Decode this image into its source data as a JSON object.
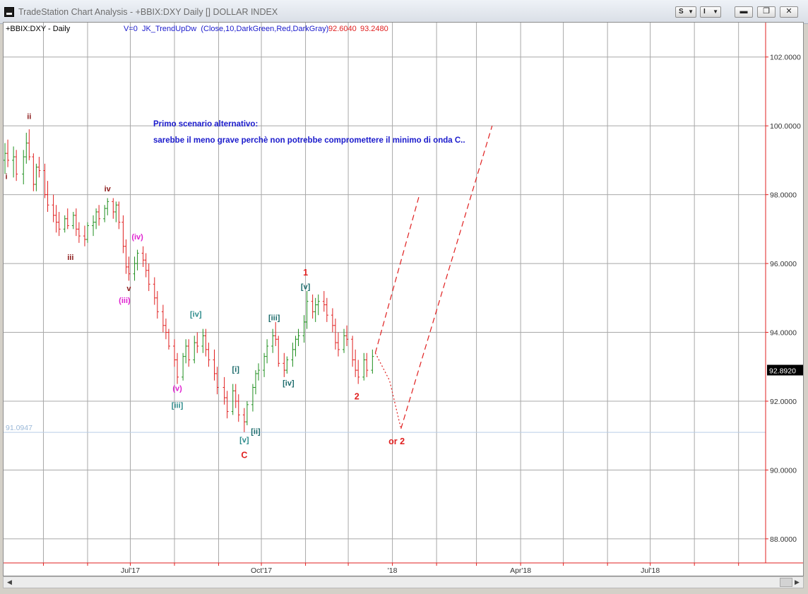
{
  "window": {
    "title": "TradeStation Chart Analysis - +BBIX:DXY Daily [] DOLLAR INDEX",
    "s_button": "S",
    "i_button": "I",
    "min": "▬",
    "max": "❐",
    "close": "✕"
  },
  "chart_data": {
    "type": "bar",
    "symbol_label": "+BBIX:DXY - Daily",
    "indicator_label": "V=0  JK_TrendUpDw  (Close,10,DarkGreen,Red,DarkGray)",
    "indicator_value1": "92.6040",
    "indicator_value2": "93.2480",
    "last_price": "92.8920",
    "ref_level": 91.0947,
    "ref_level_label": "91.0947",
    "ylim": [
      87.3,
      103.0
    ],
    "y_ticks": [
      {
        "v": 102,
        "label": "102.0000"
      },
      {
        "v": 100,
        "label": "100.0000"
      },
      {
        "v": 98,
        "label": "98.0000"
      },
      {
        "v": 96,
        "label": "96.0000"
      },
      {
        "v": 94,
        "label": "94.0000"
      },
      {
        "v": 92,
        "label": "92.0000"
      },
      {
        "v": 90,
        "label": "90.0000"
      },
      {
        "v": 88,
        "label": "88.0000"
      }
    ],
    "x_ticks": [
      {
        "date": "2017-07-01",
        "label": "Jul'17"
      },
      {
        "date": "2017-10-01",
        "label": "Oct'17"
      },
      {
        "date": "2018-01-01",
        "label": "'18"
      },
      {
        "date": "2018-04-01",
        "label": "Apr'18"
      },
      {
        "date": "2018-07-01",
        "label": "Jul'18"
      }
    ],
    "x_grid_dates": [
      "2017-05-01",
      "2017-06-01",
      "2017-07-01",
      "2017-08-01",
      "2017-09-01",
      "2017-10-01",
      "2017-11-01",
      "2017-12-01",
      "2018-01-01",
      "2018-02-01",
      "2018-03-01",
      "2018-04-01",
      "2018-05-01",
      "2018-06-01",
      "2018-07-01",
      "2018-08-01",
      "2018-09-01"
    ],
    "x_range_dates": [
      "2017-04-03",
      "2018-09-20"
    ],
    "series_colors": {
      "up": "#1f8f1f",
      "down": "#e01f1f",
      "flat": "#8a8a8a"
    },
    "bars": [
      {
        "d": "2017-04-04",
        "o": 99.0,
        "h": 99.5,
        "l": 98.6,
        "c": 99.2
      },
      {
        "d": "2017-04-06",
        "o": 99.2,
        "h": 99.6,
        "l": 98.8,
        "c": 99.0
      },
      {
        "d": "2017-04-10",
        "o": 99.0,
        "h": 99.4,
        "l": 98.5,
        "c": 99.1
      },
      {
        "d": "2017-04-12",
        "o": 99.1,
        "h": 99.3,
        "l": 98.4,
        "c": 98.6
      },
      {
        "d": "2017-04-17",
        "o": 98.6,
        "h": 99.3,
        "l": 98.3,
        "c": 99.1
      },
      {
        "d": "2017-04-19",
        "o": 99.1,
        "h": 99.8,
        "l": 98.9,
        "c": 99.5
      },
      {
        "d": "2017-04-21",
        "o": 99.5,
        "h": 99.9,
        "l": 99.0,
        "c": 99.1
      },
      {
        "d": "2017-04-24",
        "o": 99.1,
        "h": 99.2,
        "l": 98.1,
        "c": 98.3
      },
      {
        "d": "2017-04-26",
        "o": 98.3,
        "h": 98.9,
        "l": 98.1,
        "c": 98.8
      },
      {
        "d": "2017-04-28",
        "o": 98.8,
        "h": 99.1,
        "l": 98.5,
        "c": 98.7
      },
      {
        "d": "2017-05-02",
        "o": 98.7,
        "h": 98.9,
        "l": 97.9,
        "c": 98.0
      },
      {
        "d": "2017-05-04",
        "o": 98.0,
        "h": 98.4,
        "l": 97.5,
        "c": 97.7
      },
      {
        "d": "2017-05-08",
        "o": 97.7,
        "h": 98.0,
        "l": 97.2,
        "c": 97.4
      },
      {
        "d": "2017-05-10",
        "o": 97.4,
        "h": 97.7,
        "l": 96.9,
        "c": 97.2
      },
      {
        "d": "2017-05-12",
        "o": 97.2,
        "h": 97.5,
        "l": 96.8,
        "c": 97.0
      },
      {
        "d": "2017-05-16",
        "o": 97.0,
        "h": 97.4,
        "l": 96.9,
        "c": 97.3
      },
      {
        "d": "2017-05-18",
        "o": 97.3,
        "h": 97.6,
        "l": 97.0,
        "c": 97.1
      },
      {
        "d": "2017-05-22",
        "o": 97.1,
        "h": 97.5,
        "l": 97.0,
        "c": 97.4
      },
      {
        "d": "2017-05-24",
        "o": 97.4,
        "h": 97.6,
        "l": 96.8,
        "c": 97.0
      },
      {
        "d": "2017-05-26",
        "o": 97.0,
        "h": 97.2,
        "l": 96.6,
        "c": 96.8
      },
      {
        "d": "2017-05-30",
        "o": 96.8,
        "h": 97.1,
        "l": 96.5,
        "c": 96.7
      },
      {
        "d": "2017-06-01",
        "o": 96.7,
        "h": 97.2,
        "l": 96.6,
        "c": 97.1
      },
      {
        "d": "2017-06-05",
        "o": 97.1,
        "h": 97.4,
        "l": 96.8,
        "c": 97.2
      },
      {
        "d": "2017-06-07",
        "o": 97.2,
        "h": 97.6,
        "l": 97.0,
        "c": 97.5
      },
      {
        "d": "2017-06-09",
        "o": 97.5,
        "h": 97.7,
        "l": 97.1,
        "c": 97.3
      },
      {
        "d": "2017-06-13",
        "o": 97.3,
        "h": 97.7,
        "l": 97.2,
        "c": 97.6
      },
      {
        "d": "2017-06-15",
        "o": 97.6,
        "h": 97.9,
        "l": 97.4,
        "c": 97.8
      },
      {
        "d": "2017-06-19",
        "o": 97.8,
        "h": 97.9,
        "l": 97.3,
        "c": 97.5
      },
      {
        "d": "2017-06-21",
        "o": 97.5,
        "h": 97.8,
        "l": 97.2,
        "c": 97.7
      },
      {
        "d": "2017-06-23",
        "o": 97.7,
        "h": 97.8,
        "l": 97.0,
        "c": 97.2
      },
      {
        "d": "2017-06-26",
        "o": 97.2,
        "h": 97.4,
        "l": 96.3,
        "c": 96.5
      },
      {
        "d": "2017-06-28",
        "o": 96.5,
        "h": 96.7,
        "l": 95.7,
        "c": 95.9
      },
      {
        "d": "2017-06-30",
        "o": 95.9,
        "h": 96.2,
        "l": 95.5,
        "c": 95.7
      },
      {
        "d": "2017-07-04",
        "o": 95.7,
        "h": 96.2,
        "l": 95.5,
        "c": 96.0
      },
      {
        "d": "2017-07-06",
        "o": 96.0,
        "h": 96.4,
        "l": 95.8,
        "c": 96.3
      },
      {
        "d": "2017-07-10",
        "o": 96.3,
        "h": 96.5,
        "l": 95.9,
        "c": 96.1
      },
      {
        "d": "2017-07-12",
        "o": 96.1,
        "h": 96.3,
        "l": 95.6,
        "c": 95.8
      },
      {
        "d": "2017-07-14",
        "o": 95.8,
        "h": 96.0,
        "l": 95.2,
        "c": 95.4
      },
      {
        "d": "2017-07-18",
        "o": 95.4,
        "h": 95.6,
        "l": 94.8,
        "c": 95.0
      },
      {
        "d": "2017-07-20",
        "o": 95.0,
        "h": 95.2,
        "l": 94.4,
        "c": 94.6
      },
      {
        "d": "2017-07-24",
        "o": 94.6,
        "h": 94.8,
        "l": 94.0,
        "c": 94.2
      },
      {
        "d": "2017-07-26",
        "o": 94.2,
        "h": 94.4,
        "l": 93.8,
        "c": 94.0
      },
      {
        "d": "2017-07-28",
        "o": 94.0,
        "h": 94.1,
        "l": 93.5,
        "c": 93.6
      },
      {
        "d": "2017-08-01",
        "o": 93.6,
        "h": 93.8,
        "l": 93.0,
        "c": 93.2
      },
      {
        "d": "2017-08-03",
        "o": 93.2,
        "h": 93.4,
        "l": 92.5,
        "c": 92.7
      },
      {
        "d": "2017-08-07",
        "o": 92.7,
        "h": 93.4,
        "l": 92.6,
        "c": 93.3
      },
      {
        "d": "2017-08-09",
        "o": 93.3,
        "h": 93.8,
        "l": 93.1,
        "c": 93.6
      },
      {
        "d": "2017-08-11",
        "o": 93.6,
        "h": 93.8,
        "l": 93.0,
        "c": 93.2
      },
      {
        "d": "2017-08-15",
        "o": 93.2,
        "h": 93.9,
        "l": 93.1,
        "c": 93.7
      },
      {
        "d": "2017-08-17",
        "o": 93.7,
        "h": 94.0,
        "l": 93.4,
        "c": 93.6
      },
      {
        "d": "2017-08-21",
        "o": 93.6,
        "h": 94.1,
        "l": 93.4,
        "c": 93.9
      },
      {
        "d": "2017-08-23",
        "o": 93.9,
        "h": 94.1,
        "l": 93.3,
        "c": 93.5
      },
      {
        "d": "2017-08-25",
        "o": 93.5,
        "h": 93.7,
        "l": 93.0,
        "c": 93.2
      },
      {
        "d": "2017-08-29",
        "o": 93.2,
        "h": 93.5,
        "l": 92.6,
        "c": 92.8
      },
      {
        "d": "2017-08-31",
        "o": 92.8,
        "h": 93.0,
        "l": 92.2,
        "c": 92.4
      },
      {
        "d": "2017-09-05",
        "o": 92.4,
        "h": 92.7,
        "l": 91.9,
        "c": 92.1
      },
      {
        "d": "2017-09-07",
        "o": 92.1,
        "h": 92.3,
        "l": 91.5,
        "c": 91.7
      },
      {
        "d": "2017-09-11",
        "o": 91.7,
        "h": 92.5,
        "l": 91.6,
        "c": 92.3
      },
      {
        "d": "2017-09-13",
        "o": 92.3,
        "h": 92.5,
        "l": 91.8,
        "c": 92.0
      },
      {
        "d": "2017-09-15",
        "o": 92.0,
        "h": 92.2,
        "l": 91.4,
        "c": 91.6
      },
      {
        "d": "2017-09-19",
        "o": 91.6,
        "h": 91.8,
        "l": 91.1,
        "c": 91.4
      },
      {
        "d": "2017-09-21",
        "o": 91.4,
        "h": 92.0,
        "l": 91.3,
        "c": 91.9
      },
      {
        "d": "2017-09-25",
        "o": 91.9,
        "h": 92.5,
        "l": 91.7,
        "c": 92.4
      },
      {
        "d": "2017-09-27",
        "o": 92.4,
        "h": 92.9,
        "l": 92.2,
        "c": 92.8
      },
      {
        "d": "2017-09-29",
        "o": 92.8,
        "h": 93.1,
        "l": 92.6,
        "c": 92.9
      },
      {
        "d": "2017-10-03",
        "o": 92.9,
        "h": 93.4,
        "l": 92.7,
        "c": 93.3
      },
      {
        "d": "2017-10-05",
        "o": 93.3,
        "h": 93.8,
        "l": 93.1,
        "c": 93.6
      },
      {
        "d": "2017-10-09",
        "o": 93.6,
        "h": 94.1,
        "l": 93.4,
        "c": 93.9
      },
      {
        "d": "2017-10-11",
        "o": 93.9,
        "h": 94.3,
        "l": 93.6,
        "c": 93.8
      },
      {
        "d": "2017-10-13",
        "o": 93.8,
        "h": 93.9,
        "l": 93.0,
        "c": 93.1
      },
      {
        "d": "2017-10-17",
        "o": 93.1,
        "h": 93.4,
        "l": 92.7,
        "c": 92.9
      },
      {
        "d": "2017-10-19",
        "o": 92.9,
        "h": 93.3,
        "l": 92.8,
        "c": 93.2
      },
      {
        "d": "2017-10-23",
        "o": 93.2,
        "h": 93.7,
        "l": 93.0,
        "c": 93.5
      },
      {
        "d": "2017-10-25",
        "o": 93.5,
        "h": 93.9,
        "l": 93.3,
        "c": 93.8
      },
      {
        "d": "2017-10-27",
        "o": 93.8,
        "h": 94.1,
        "l": 93.6,
        "c": 93.9
      },
      {
        "d": "2017-10-31",
        "o": 93.9,
        "h": 94.5,
        "l": 93.7,
        "c": 94.3
      },
      {
        "d": "2017-11-02",
        "o": 94.3,
        "h": 95.2,
        "l": 94.1,
        "c": 94.9
      },
      {
        "d": "2017-11-06",
        "o": 94.9,
        "h": 95.1,
        "l": 94.4,
        "c": 94.6
      },
      {
        "d": "2017-11-08",
        "o": 94.6,
        "h": 95.0,
        "l": 94.3,
        "c": 94.8
      },
      {
        "d": "2017-11-10",
        "o": 94.8,
        "h": 95.1,
        "l": 94.5,
        "c": 94.9
      },
      {
        "d": "2017-11-14",
        "o": 94.9,
        "h": 95.2,
        "l": 94.6,
        "c": 94.8
      },
      {
        "d": "2017-11-16",
        "o": 94.8,
        "h": 95.0,
        "l": 94.3,
        "c": 94.5
      },
      {
        "d": "2017-11-20",
        "o": 94.5,
        "h": 94.7,
        "l": 94.0,
        "c": 94.2
      },
      {
        "d": "2017-11-22",
        "o": 94.2,
        "h": 94.4,
        "l": 93.5,
        "c": 93.7
      },
      {
        "d": "2017-11-24",
        "o": 93.7,
        "h": 94.0,
        "l": 93.3,
        "c": 93.5
      },
      {
        "d": "2017-11-28",
        "o": 93.5,
        "h": 94.1,
        "l": 93.4,
        "c": 93.9
      },
      {
        "d": "2017-11-30",
        "o": 93.9,
        "h": 94.2,
        "l": 93.6,
        "c": 93.8
      },
      {
        "d": "2017-12-04",
        "o": 93.8,
        "h": 93.9,
        "l": 93.0,
        "c": 93.2
      },
      {
        "d": "2017-12-06",
        "o": 93.2,
        "h": 93.5,
        "l": 92.7,
        "c": 92.9
      },
      {
        "d": "2017-12-08",
        "o": 92.9,
        "h": 93.2,
        "l": 92.5,
        "c": 92.7
      },
      {
        "d": "2017-12-12",
        "o": 92.7,
        "h": 93.4,
        "l": 92.6,
        "c": 93.2
      },
      {
        "d": "2017-12-14",
        "o": 93.2,
        "h": 93.4,
        "l": 92.7,
        "c": 92.9
      },
      {
        "d": "2017-12-18",
        "o": 92.9,
        "h": 93.5,
        "l": 92.8,
        "c": 93.3
      }
    ],
    "projection_solid": [
      {
        "d": "2017-12-20",
        "v": 93.4
      },
      {
        "d": "2018-01-20",
        "v": 98.0
      }
    ],
    "projection_dotted": [
      {
        "d": "2017-12-20",
        "v": 93.4
      },
      {
        "d": "2017-12-30",
        "v": 92.6
      },
      {
        "d": "2018-01-07",
        "v": 91.2
      }
    ],
    "projection_dashed": [
      {
        "d": "2018-01-07",
        "v": 91.2
      },
      {
        "d": "2018-03-12",
        "v": 100.0
      }
    ],
    "wave_labels": [
      {
        "text": "i",
        "d": "2017-04-05",
        "v": 98.45,
        "color": "#8b1a1a"
      },
      {
        "text": "ii",
        "d": "2017-04-21",
        "v": 100.2,
        "color": "#8b1a1a"
      },
      {
        "text": "iii",
        "d": "2017-05-20",
        "v": 96.1,
        "color": "#8b1a1a"
      },
      {
        "text": "iv",
        "d": "2017-06-15",
        "v": 98.1,
        "color": "#8b1a1a"
      },
      {
        "text": "v",
        "d": "2017-06-30",
        "v": 95.2,
        "color": "#8b1a1a"
      },
      {
        "text": "(iv)",
        "d": "2017-07-06",
        "v": 96.7,
        "color": "#e020d0"
      },
      {
        "text": "(iii)",
        "d": "2017-06-27",
        "v": 94.85,
        "color": "#e020d0"
      },
      {
        "text": "(v)",
        "d": "2017-08-03",
        "v": 92.3,
        "color": "#e020d0"
      },
      {
        "text": "[iii]",
        "d": "2017-08-03",
        "v": 91.8,
        "color": "#2a8a8a"
      },
      {
        "text": "[iv]",
        "d": "2017-08-16",
        "v": 94.45,
        "color": "#2a8a8a"
      },
      {
        "text": "[i]",
        "d": "2017-09-13",
        "v": 92.85,
        "color": "#1a6a6a"
      },
      {
        "text": "[ii]",
        "d": "2017-09-27",
        "v": 91.05,
        "color": "#1a6a6a"
      },
      {
        "text": "[v]",
        "d": "2017-09-19",
        "v": 90.8,
        "color": "#2a8a8a"
      },
      {
        "text": "C",
        "d": "2017-09-19",
        "v": 90.35,
        "color": "#e01f1f"
      },
      {
        "text": "[iii]",
        "d": "2017-10-10",
        "v": 94.35,
        "color": "#1a6a6a"
      },
      {
        "text": "[iv]",
        "d": "2017-10-20",
        "v": 92.45,
        "color": "#1a6a6a"
      },
      {
        "text": "1",
        "d": "2017-11-01",
        "v": 95.65,
        "color": "#e01f1f"
      },
      {
        "text": "[v]",
        "d": "2017-11-01",
        "v": 95.25,
        "color": "#1a6a6a"
      },
      {
        "text": "2",
        "d": "2017-12-07",
        "v": 92.05,
        "color": "#e01f1f"
      },
      {
        "text": "or 2",
        "d": "2018-01-04",
        "v": 90.75,
        "color": "#e01f1f"
      }
    ],
    "annotation": {
      "line1": "Primo scenario alternativo:",
      "line2": "sarebbe il meno grave perchè non potrebbe compromettere il minimo di onda C..",
      "color": "#1a1acc"
    }
  }
}
